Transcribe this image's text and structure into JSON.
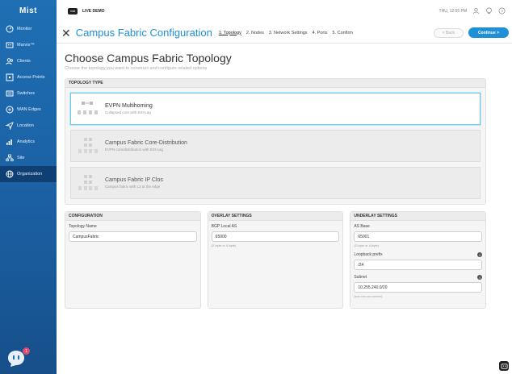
{
  "app": {
    "logo_text": "Mist"
  },
  "sidebar": {
    "items": [
      {
        "label": "Monitor",
        "icon": "monitor-icon"
      },
      {
        "label": "Marvis™",
        "icon": "marvis-icon"
      },
      {
        "label": "Clients",
        "icon": "clients-icon"
      },
      {
        "label": "Access Points",
        "icon": "access-point-icon"
      },
      {
        "label": "Switches",
        "icon": "switches-icon"
      },
      {
        "label": "WAN Edges",
        "icon": "wan-edge-icon"
      },
      {
        "label": "Location",
        "icon": "location-icon"
      },
      {
        "label": "Analytics",
        "icon": "analytics-icon"
      },
      {
        "label": "Site",
        "icon": "site-icon"
      },
      {
        "label": "Organization",
        "icon": "organization-icon"
      }
    ],
    "chat_badge": "1"
  },
  "topbar": {
    "demo_logo": "mist",
    "demo_label": "LIVE DEMO",
    "datetime": "THU, 12:55 PM"
  },
  "wizard": {
    "title": "Campus Fabric Configuration",
    "steps": [
      "1. Topology",
      "2. Nodes",
      "3. Network Settings",
      "4. Ports",
      "5. Confirm"
    ],
    "back_label": "< Back",
    "continue_label": "Continue >"
  },
  "page": {
    "title": "Choose Campus Fabric Topology",
    "subtitle": "Choose the topology you want to construct and configure related options"
  },
  "topology": {
    "header": "TOPOLOGY TYPE",
    "options": [
      {
        "name": "EVPN Multihoming",
        "desc": "Collapsed core with ESI-Lag"
      },
      {
        "name": "Campus Fabric Core-Distribution",
        "desc": "EVPN core/distribution with ESI-Lag"
      },
      {
        "name": "Campus Fabric IP Clos",
        "desc": "Campus fabric with L3 at the edge"
      }
    ]
  },
  "configuration": {
    "header": "CONFIGURATION",
    "topology_name_label": "Topology Name",
    "topology_name_value": "CampusFabric"
  },
  "overlay": {
    "header": "OVERLAY SETTINGS",
    "bgp_label": "BGP Local AS",
    "bgp_value": "65000",
    "bgp_hint": "(2-byte or 4-byte)"
  },
  "underlay": {
    "header": "UNDERLAY SETTINGS",
    "as_base_label": "AS Base",
    "as_base_value": "65001",
    "as_base_hint": "(2-byte or 4-byte)",
    "loopback_label": "Loopback prefix",
    "loopback_value": "/24",
    "subnet_label": "Subnet",
    "subnet_value": "10.255.240.0/20",
    "subnet_hint": "(xxx.xxx.xxx.xxx/xx)"
  },
  "colors": {
    "accent": "#1f8fd6",
    "sidebar": "#1f6fb5",
    "selected_border": "#6ec8e8"
  }
}
